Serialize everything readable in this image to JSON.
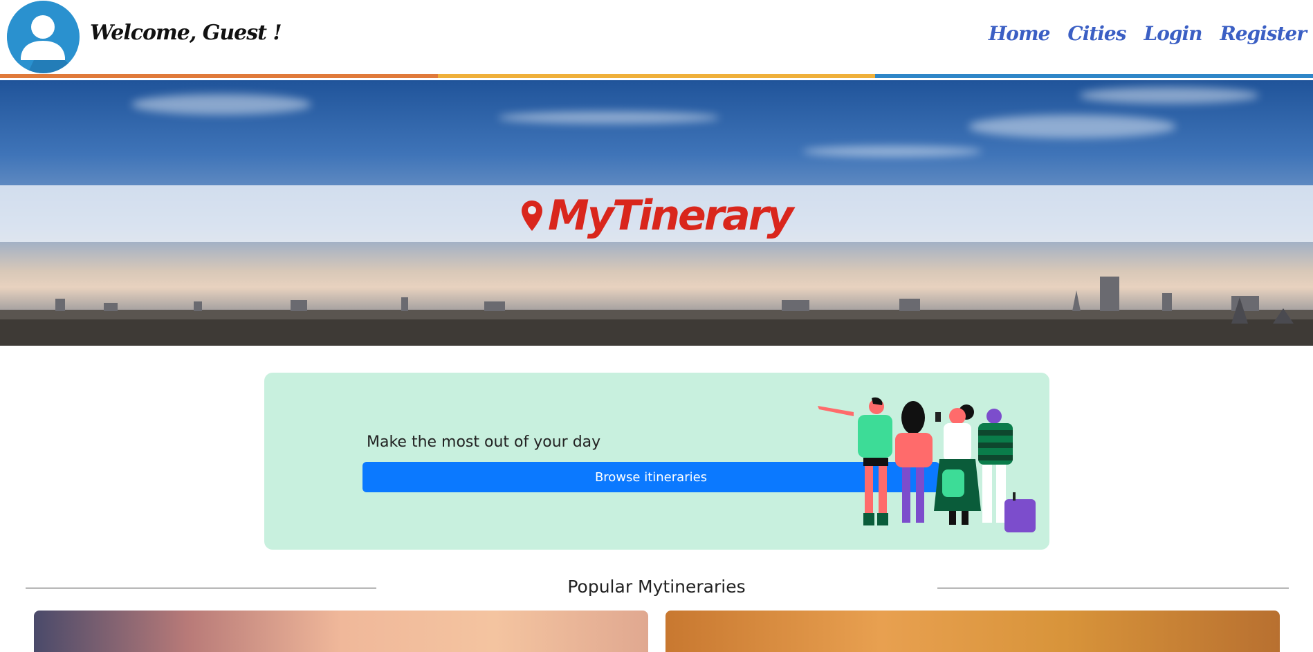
{
  "header": {
    "welcome": "Welcome, Guest !",
    "avatar_icon": "user-icon",
    "nav": [
      {
        "label": "Home"
      },
      {
        "label": "Cities"
      },
      {
        "label": "Login"
      },
      {
        "label": "Register"
      }
    ],
    "stripe_colors": [
      "#e07a3a",
      "#efb03a",
      "#2e86c8"
    ]
  },
  "hero": {
    "logo_text": "MyTinerary",
    "logo_icon": "map-pin-icon",
    "logo_color": "#d9261c"
  },
  "promo": {
    "title": "Make the most out of your day",
    "button_label": "Browse itineraries",
    "button_color": "#0b79ff",
    "background": "#c8f0de"
  },
  "popular": {
    "title": "Popular Mytineraries"
  }
}
